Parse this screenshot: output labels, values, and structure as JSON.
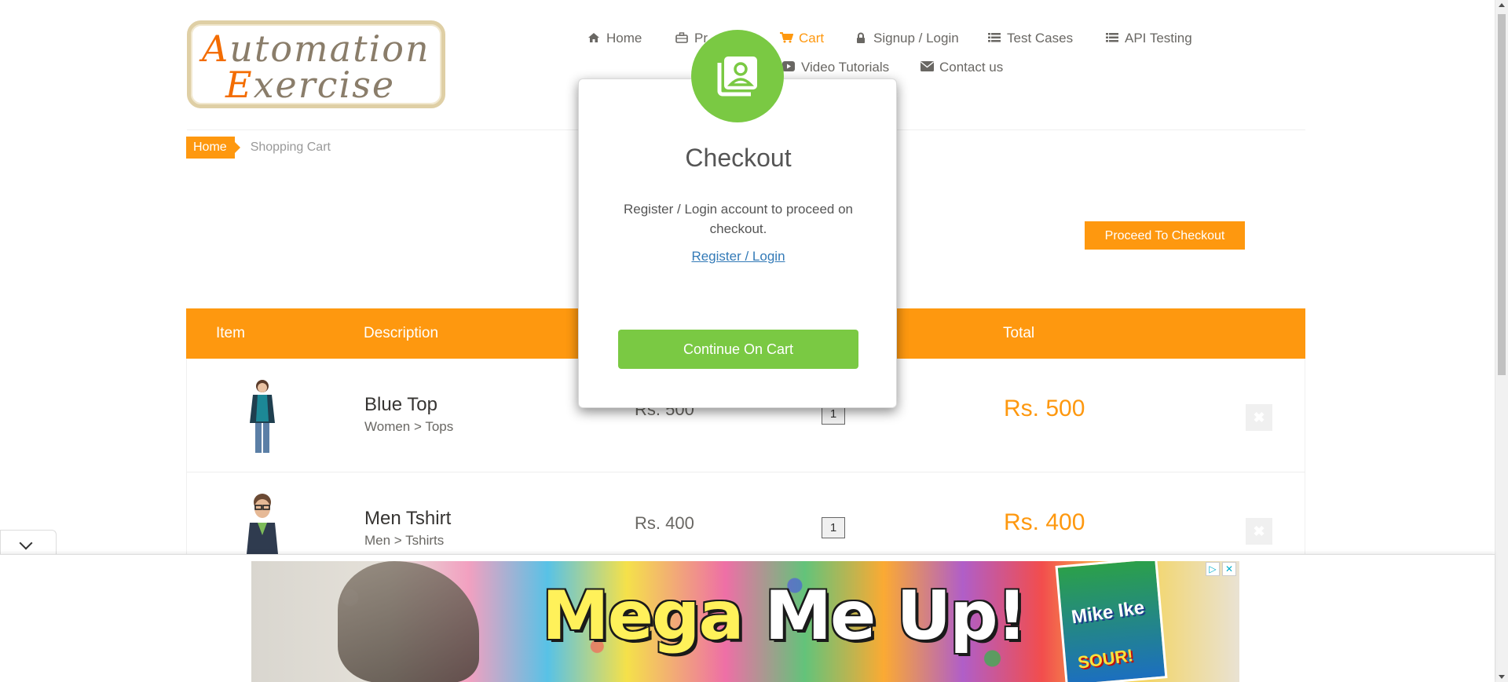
{
  "header": {
    "logo_line1_cap": "A",
    "logo_line1_rest": "utomation",
    "logo_line2_cap": "E",
    "logo_line2_rest": "xercise",
    "nav": [
      {
        "label": "Home",
        "icon": "home-icon"
      },
      {
        "label": "Pr",
        "icon": "briefcase-icon"
      },
      {
        "label": "Cart",
        "icon": "cart-icon",
        "active": true
      },
      {
        "label": "Signup / Login",
        "icon": "lock-icon"
      },
      {
        "label": "Test Cases",
        "icon": "list-icon"
      },
      {
        "label": "API Testing",
        "icon": "list-icon"
      },
      {
        "label": "Video Tutorials",
        "icon": "youtube-icon"
      },
      {
        "label": "Contact us",
        "icon": "envelope-icon"
      }
    ]
  },
  "breadcrumb": {
    "home": "Home",
    "current": "Shopping Cart"
  },
  "proceed_label": "Proceed To Checkout",
  "table": {
    "headers": {
      "item": "Item",
      "description": "Description",
      "total": "Total"
    },
    "rows": [
      {
        "name": "Blue Top",
        "category": "Women > Tops",
        "price": "Rs. 500",
        "quantity": "1",
        "total": "Rs. 500"
      },
      {
        "name": "Men Tshirt",
        "category": "Men > Tshirts",
        "price": "Rs. 400",
        "quantity": "1",
        "total": "Rs. 400"
      }
    ]
  },
  "modal": {
    "title": "Checkout",
    "text": "Register / Login account to proceed on checkout.",
    "link": "Register / Login",
    "button": "Continue On Cart",
    "accent": "#7ac943"
  },
  "ad": {
    "headline_1": "Mega",
    "headline_2": "Me Up!",
    "pack_line1": "Mike Ike",
    "pack_line2": "SOUR!"
  },
  "colors": {
    "brand": "#fe980f",
    "modal_green": "#7ac943"
  }
}
